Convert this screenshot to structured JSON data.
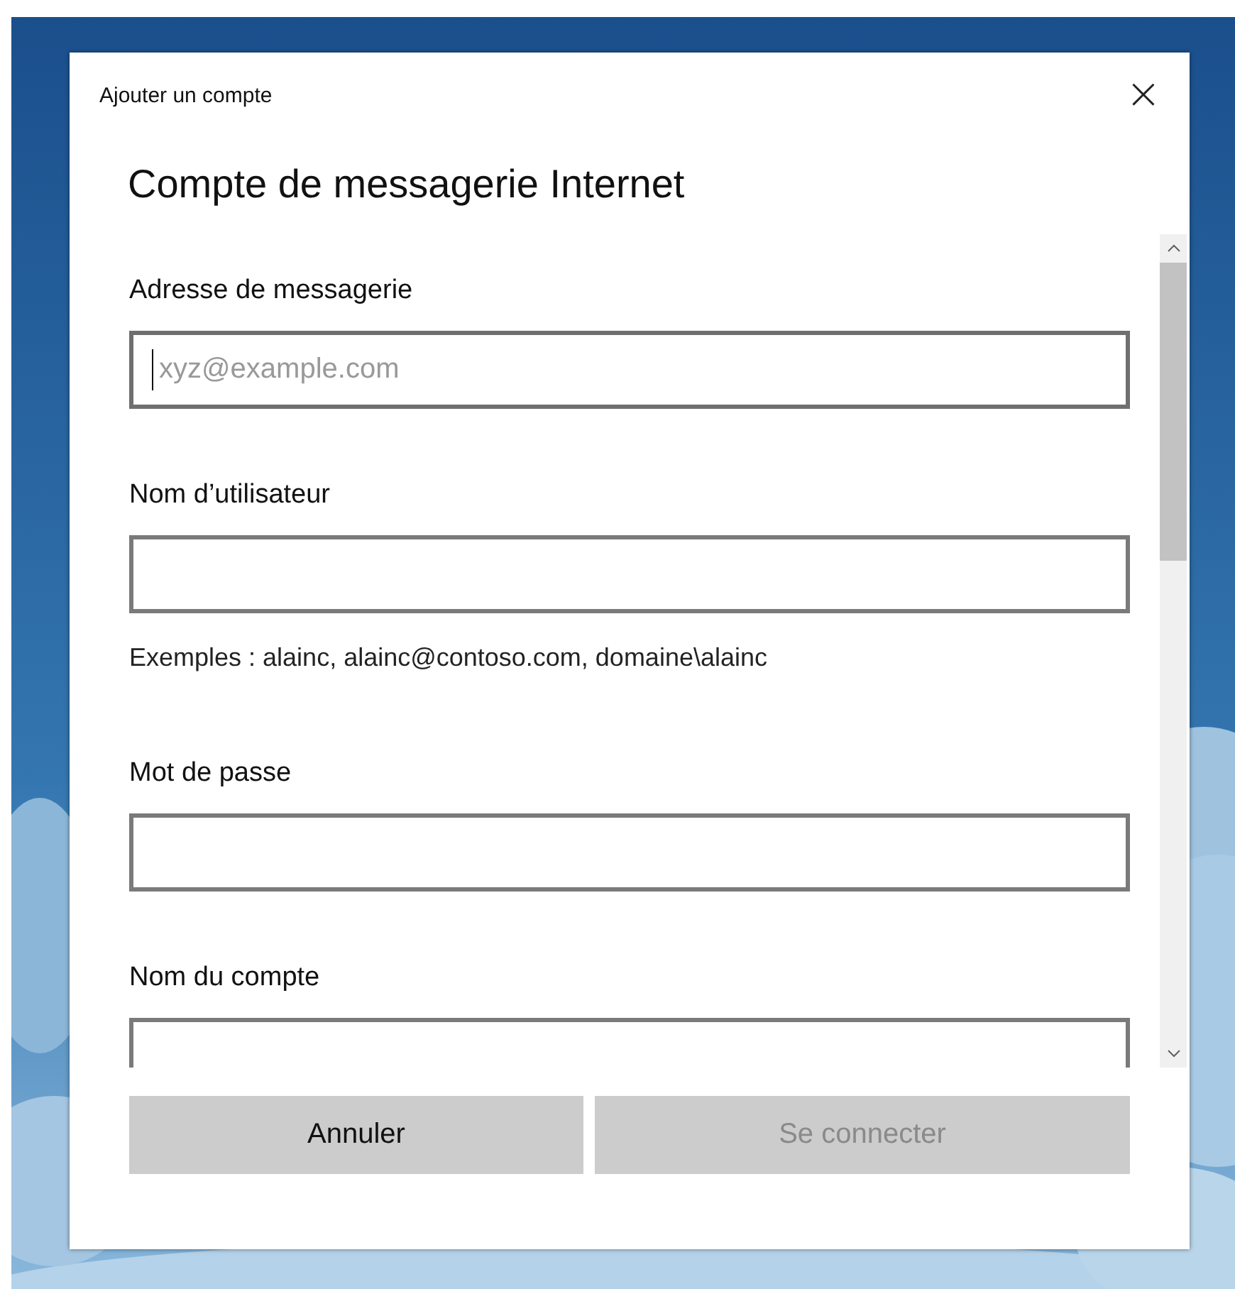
{
  "window": {
    "title": "Ajouter un compte",
    "close": "×"
  },
  "heading": "Compte de messagerie Internet",
  "fields": [
    {
      "label": "Adresse de messagerie",
      "placeholder": "xyz@example.com",
      "focused": true
    },
    {
      "label": "Nom d’utilisateur",
      "helper": "Exemples : alainc, alainc@contoso.com, domaine\\alainc",
      "focused": false
    },
    {
      "label": "Mot de passe",
      "focused": false
    },
    {
      "label": "Nom du compte",
      "focused": false
    }
  ],
  "buttons": [
    {
      "label": "Annuler",
      "disabled": false
    },
    {
      "label": "Se connecter",
      "disabled": true
    }
  ]
}
